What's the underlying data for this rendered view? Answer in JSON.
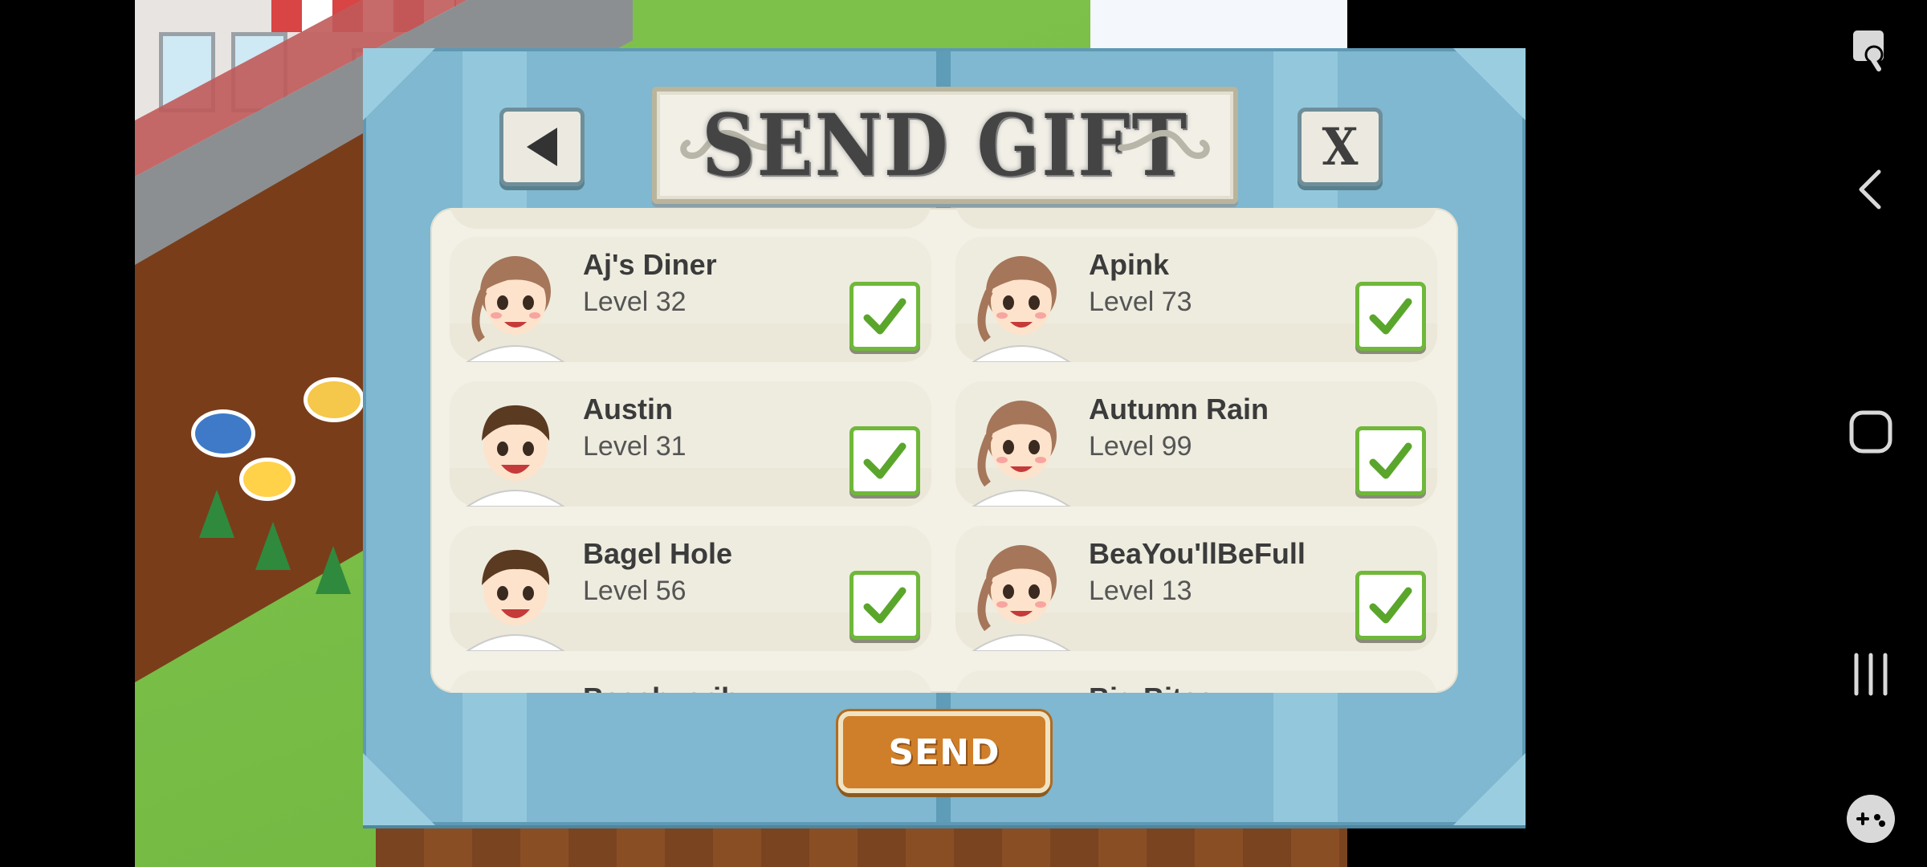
{
  "dialog": {
    "title": "SEND GIFT",
    "send_label": "SEND",
    "close_label": "X"
  },
  "friends": [
    {
      "name": "Aj's Diner",
      "level": "Level 32",
      "checked": true,
      "avatar": "chef-girl"
    },
    {
      "name": "Apink",
      "level": "Level 73",
      "checked": true,
      "avatar": "chef-girl"
    },
    {
      "name": "Austin",
      "level": "Level 31",
      "checked": true,
      "avatar": "chef-boy"
    },
    {
      "name": "Autumn Rain",
      "level": "Level 99",
      "checked": true,
      "avatar": "chef-girl"
    },
    {
      "name": "Bagel Hole",
      "level": "Level 56",
      "checked": true,
      "avatar": "chef-boy"
    },
    {
      "name": "BeaYou'llBeFull",
      "level": "Level 13",
      "checked": true,
      "avatar": "chef-girl"
    }
  ],
  "partial_friends": [
    "Beachyerib",
    "Big Bites"
  ],
  "colors": {
    "panel_blue": "#7fb8d0",
    "check_green": "#6fb83a",
    "send_orange": "#cf7f2a"
  },
  "icons": {
    "back": "back-arrow-icon",
    "close": "close-icon",
    "check": "checkmark-icon",
    "nav_accessibility": "accessibility-icon",
    "nav_back": "chevron-left-icon",
    "nav_home": "home-square-icon",
    "nav_recents": "recents-icon",
    "nav_game": "gamepad-icon"
  }
}
